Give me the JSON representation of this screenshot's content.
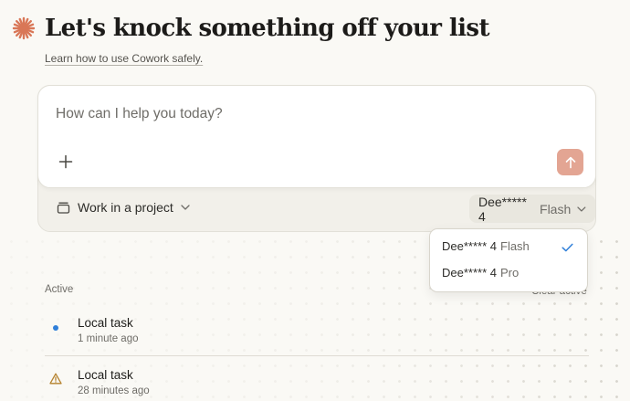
{
  "header": {
    "title": "Let's knock something off your list",
    "learn_link": "Learn how to use Cowork safely."
  },
  "composer": {
    "placeholder": "How can I help you today?",
    "project_label": "Work in a project",
    "model": {
      "name": "Dee***** 4",
      "variant": "Flash"
    }
  },
  "model_menu": {
    "items": [
      {
        "name": "Dee***** 4",
        "variant": "Flash",
        "selected": true
      },
      {
        "name": "Dee***** 4",
        "variant": "Pro",
        "selected": false
      }
    ]
  },
  "tasks": {
    "section_label": "Active",
    "clear_label": "Clear active",
    "items": [
      {
        "name": "Local task",
        "time": "1 minute ago",
        "status": "running",
        "icon": "blue-dot-icon"
      },
      {
        "name": "Local task",
        "time": "28 minutes ago",
        "status": "warning",
        "icon": "warning-icon"
      }
    ]
  },
  "colors": {
    "accent": "#d97757",
    "send_button": "#e3a593",
    "background": "#faf9f5",
    "check": "#2f7fd9"
  }
}
